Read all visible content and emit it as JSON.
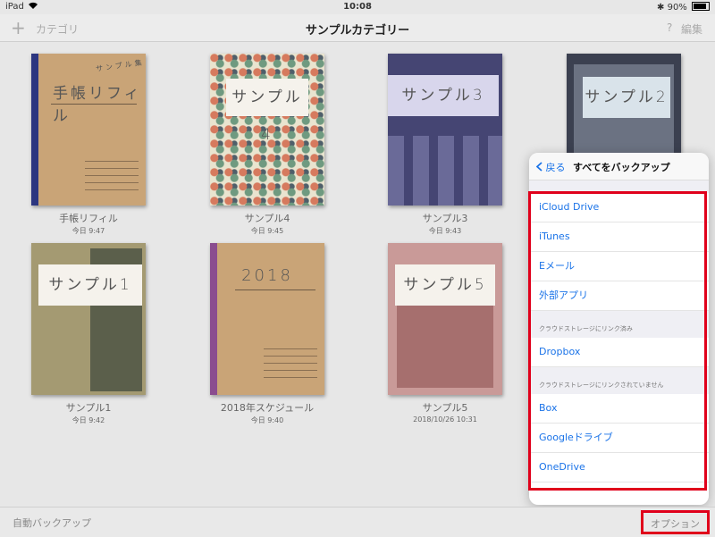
{
  "status_bar": {
    "device": "iPad",
    "wifi_icon": "wifi-icon",
    "time": "10:08",
    "bluetooth": "✱",
    "battery": "90%"
  },
  "nav": {
    "add": "+",
    "category": "カテゴリ",
    "title": "サンプルカテゴリー",
    "help": "?",
    "edit": "編集"
  },
  "notebooks": [
    {
      "title": "手帳リフィル",
      "date": "今日 9:47",
      "cover_text": "手帳リフィル",
      "tag": "サンプル集"
    },
    {
      "title": "サンプル4",
      "date": "今日 9:45",
      "cover_text": "サンプル4"
    },
    {
      "title": "サンプル3",
      "date": "今日 9:43",
      "cover_text": "サンプル3"
    },
    {
      "title": "",
      "date": "",
      "cover_text": "サンプル2"
    },
    {
      "title": "サンプル1",
      "date": "今日 9:42",
      "cover_text": "サンプル1"
    },
    {
      "title": "2018年スケジュール",
      "date": "今日 9:40",
      "cover_text": "2018"
    },
    {
      "title": "サンプル5",
      "date": "2018/10/26 10:31",
      "cover_text": "サンプル5"
    }
  ],
  "popover": {
    "back": "戻る",
    "title": "すべてをバックアップ",
    "items": [
      "iCloud Drive",
      "iTunes",
      "Eメール",
      "外部アプリ"
    ],
    "linked_header": "クラウドストレージにリンク済み",
    "linked_items": [
      "Dropbox"
    ],
    "unlinked_header": "クラウドストレージにリンクされていません",
    "unlinked_items": [
      "Box",
      "Googleドライブ",
      "OneDrive"
    ]
  },
  "bottom": {
    "auto_backup": "自動バックアップ",
    "options": "オプション"
  },
  "colors": {
    "accent": "#1a73e8",
    "highlight": "#e0001b"
  }
}
